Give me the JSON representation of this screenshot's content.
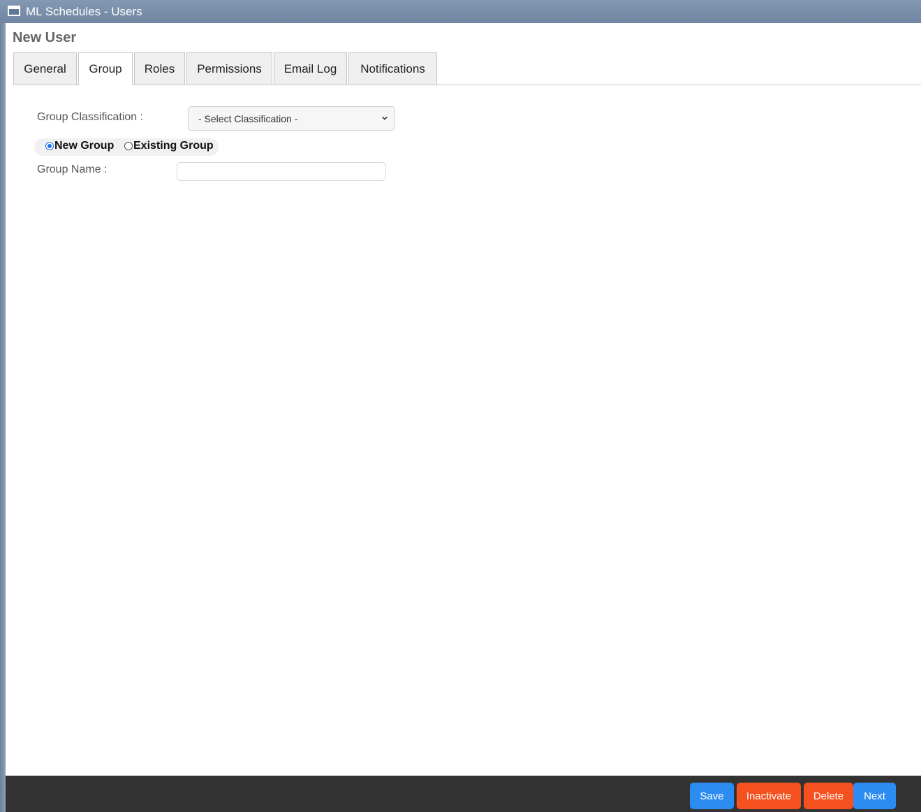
{
  "window": {
    "title": "ML Schedules - Users",
    "icon": "window-icon"
  },
  "page": {
    "title": "New User"
  },
  "tabs": [
    {
      "label": "General",
      "active": false
    },
    {
      "label": "Group",
      "active": true
    },
    {
      "label": "Roles",
      "active": false
    },
    {
      "label": "Permissions",
      "active": false
    },
    {
      "label": "Email Log",
      "active": false
    },
    {
      "label": "Notifications",
      "active": false
    }
  ],
  "form": {
    "classification_label": "Group Classification :",
    "classification_value": "- Select Classification -",
    "radio_new": "New Group",
    "radio_existing": "Existing Group",
    "selected_radio": "New Group",
    "group_name_label": "Group Name :",
    "group_name_value": ""
  },
  "footer": {
    "save": "Save",
    "inactivate": "Inactivate",
    "delete": "Delete",
    "next": "Next"
  },
  "colors": {
    "primary_button": "#2d8cf0",
    "danger_button": "#f4511e",
    "titlebar": "#7890ac",
    "footer": "#333333"
  }
}
